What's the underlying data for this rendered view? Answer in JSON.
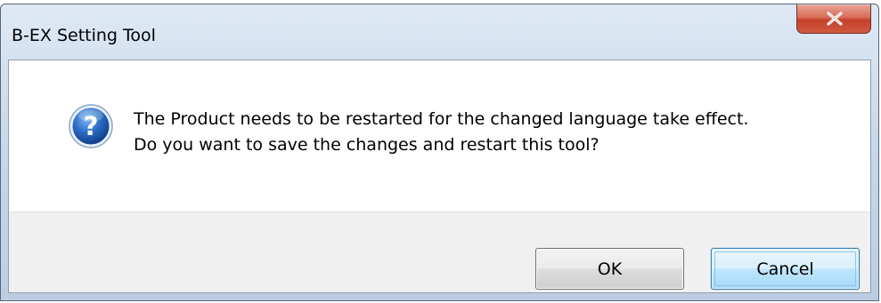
{
  "window": {
    "title": "B-EX Setting Tool",
    "close_icon": "close-x-icon"
  },
  "dialog": {
    "icon": "question-icon",
    "message_line1": "The Product needs to be restarted for the changed language take effect.",
    "message_line2": "Do you want to save the changes and restart this tool?",
    "accent_color": "#2a6bc4"
  },
  "buttons": {
    "ok_label": "OK",
    "cancel_label": "Cancel"
  }
}
